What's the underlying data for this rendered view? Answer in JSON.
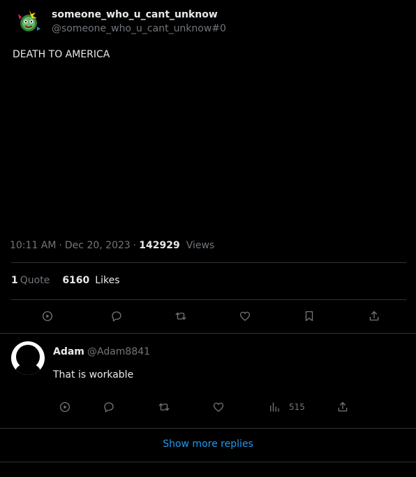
{
  "tweet": {
    "author_name": "someone_who_u_cant_unknow",
    "author_handle": "@someone_who_u_cant_unknow#0",
    "text": "DEATH TO AMERICA",
    "time": "10:11 AM",
    "date": "Dec 20, 2023",
    "separator": "·",
    "views_count": "142929",
    "views_label": "Views",
    "quotes_count": "1",
    "quotes_label": "Quote",
    "likes_count": "6160",
    "likes_label": "Likes",
    "actions": [
      "play-icon",
      "reply-icon",
      "retweet-icon",
      "like-icon",
      "bookmark-icon",
      "share-icon"
    ]
  },
  "reply": {
    "author_name": "Adam",
    "author_handle": "@Adam8841",
    "text": "That is workable",
    "views_count": "515",
    "actions": [
      "play-icon",
      "reply-icon",
      "retweet-icon",
      "like-icon",
      "analytics-icon",
      "share-icon"
    ]
  },
  "show_more_label": "Show more replies",
  "colors": {
    "background": "#000000",
    "primary_text": "#e7e9ea",
    "secondary_text": "#71767b",
    "divider": "#2f3336",
    "link": "#1d9bf0"
  }
}
